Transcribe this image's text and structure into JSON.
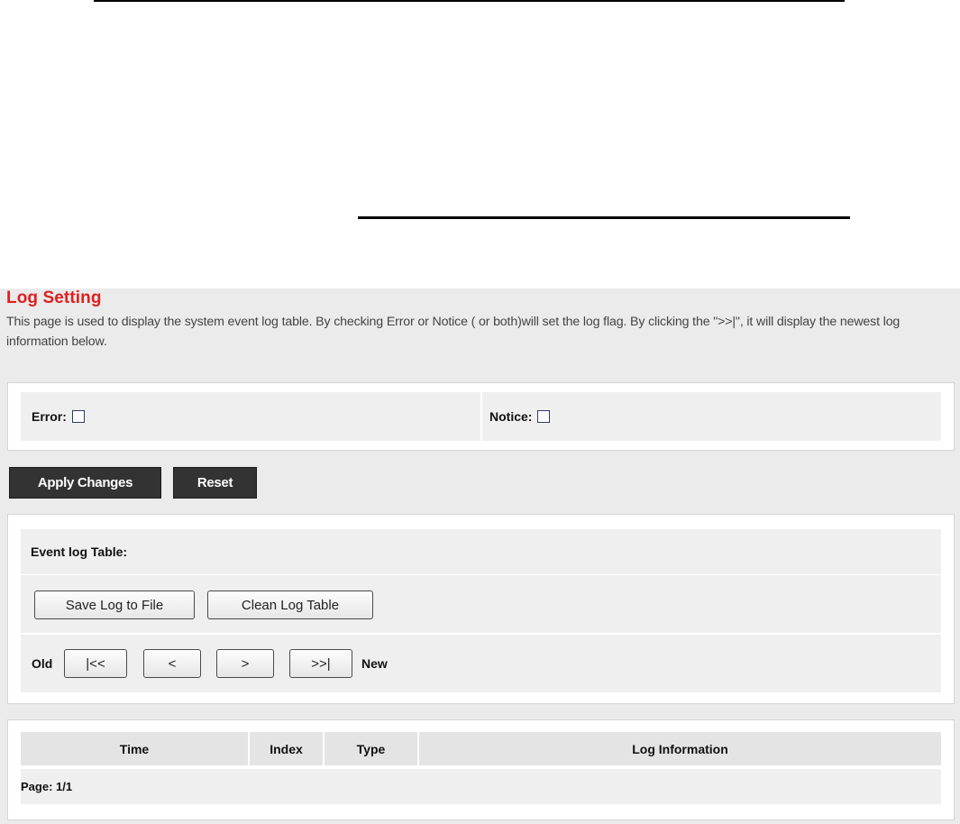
{
  "page": {
    "title": "Log Setting",
    "description": "This page is used to display the system event log table. By checking Error or Notice ( or both)will set the log flag. By clicking the \">>|\", it will display the newest log information below."
  },
  "flags": {
    "error_label": "Error:",
    "error_checked": false,
    "notice_label": "Notice:",
    "notice_checked": false
  },
  "actions": {
    "apply_label": "Apply Changes",
    "reset_label": "Reset"
  },
  "event_log": {
    "heading": "Event log Table:",
    "save_label": "Save Log to File",
    "clean_label": "Clean Log Table",
    "old_label": "Old",
    "new_label": "New",
    "first_label": "|<<",
    "prev_label": "<",
    "next_label": ">",
    "last_label": ">>|"
  },
  "log_table": {
    "columns": [
      "Time",
      "Index",
      "Type",
      "Log Information"
    ],
    "rows": [],
    "page_label": "Page: 1/1"
  }
}
